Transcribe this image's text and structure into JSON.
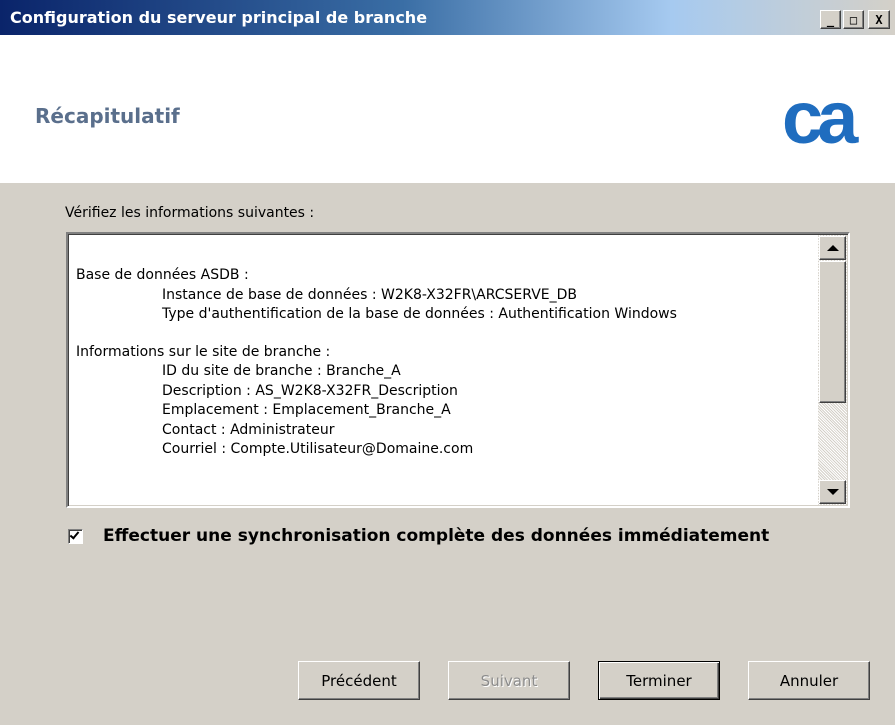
{
  "window": {
    "title": "Configuration du serveur principal de branche",
    "buttons": {
      "minimize": "_",
      "maximize": "□",
      "close": "X"
    }
  },
  "header": {
    "title": "Récapitulatif",
    "logo_text": "ca",
    "logo_color": "#1f6dbf"
  },
  "prompt": "Vérifiez les informations suivantes :",
  "summary": {
    "lines": [
      {
        "text": "Base de données ASDB :",
        "indent": false
      },
      {
        "text": "Instance de base de données : W2K8-X32FR\\ARCSERVE_DB",
        "indent": true
      },
      {
        "text": "Type d'authentification de la base de données : Authentification Windows",
        "indent": true
      },
      {
        "text": "Informations sur le site de branche :",
        "indent": false
      },
      {
        "text": "ID du site de branche : Branche_A",
        "indent": true
      },
      {
        "text": "Description : AS_W2K8-X32FR_Description",
        "indent": true
      },
      {
        "text": "Emplacement : Emplacement_Branche_A",
        "indent": true
      },
      {
        "text": "Contact : Administrateur",
        "indent": true
      },
      {
        "text": "Courriel : Compte.Utilisateur@Domaine.com",
        "indent": true
      }
    ]
  },
  "sync": {
    "label": "Effectuer une synchronisation complète des données immédiatement",
    "checked": true
  },
  "buttons": {
    "previous": "Précédent",
    "next": "Suivant",
    "finish": "Terminer",
    "cancel": "Annuler"
  }
}
